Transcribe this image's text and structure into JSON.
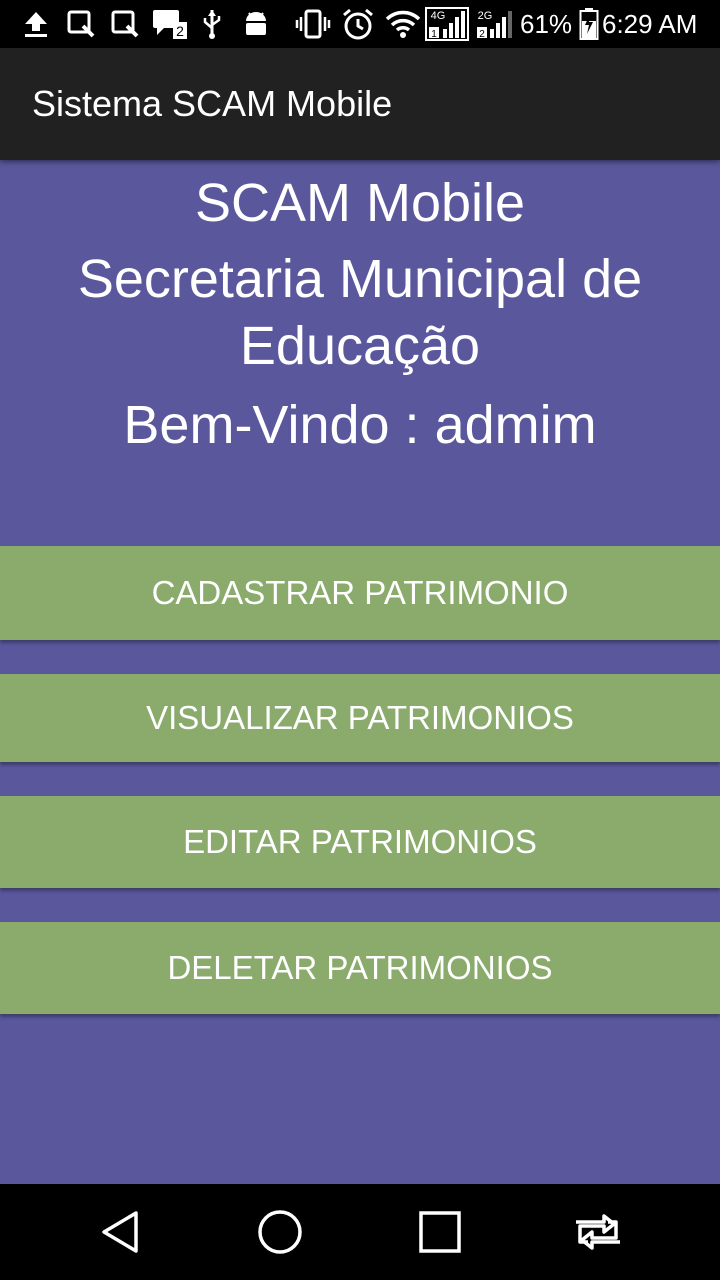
{
  "status_bar": {
    "battery_percent": "61%",
    "time": "6:29 AM",
    "network_4g": "4G",
    "network_2g": "2G",
    "sim1": "1",
    "sim2": "2",
    "icons": [
      "upload-icon",
      "screenshot-icon",
      "screenshot-icon",
      "sim-message-icon",
      "usb-icon",
      "android-debug-icon",
      "vibrate-icon",
      "alarm-icon",
      "wifi-icon",
      "signal-4g-icon",
      "signal-2g-icon",
      "battery-icon"
    ]
  },
  "app_bar": {
    "title": "Sistema SCAM Mobile"
  },
  "header": {
    "app_name": "SCAM Mobile",
    "org_line1": "Secretaria Municipal de",
    "org_line2": "Educação",
    "welcome": "Bem-Vindo : admim"
  },
  "menu": {
    "buttons": [
      {
        "label": "CADASTRAR PATRIMONIO"
      },
      {
        "label": "VISUALIZAR PATRIMONIOS"
      },
      {
        "label": "EDITAR PATRIMONIOS"
      },
      {
        "label": "DELETAR PATRIMONIOS"
      }
    ]
  },
  "colors": {
    "background": "#5a579c",
    "button": "#8aab6c",
    "app_bar": "#212121"
  },
  "nav_bar": {
    "icons": [
      "back-icon",
      "home-icon",
      "recents-icon",
      "screen-switch-icon"
    ]
  }
}
